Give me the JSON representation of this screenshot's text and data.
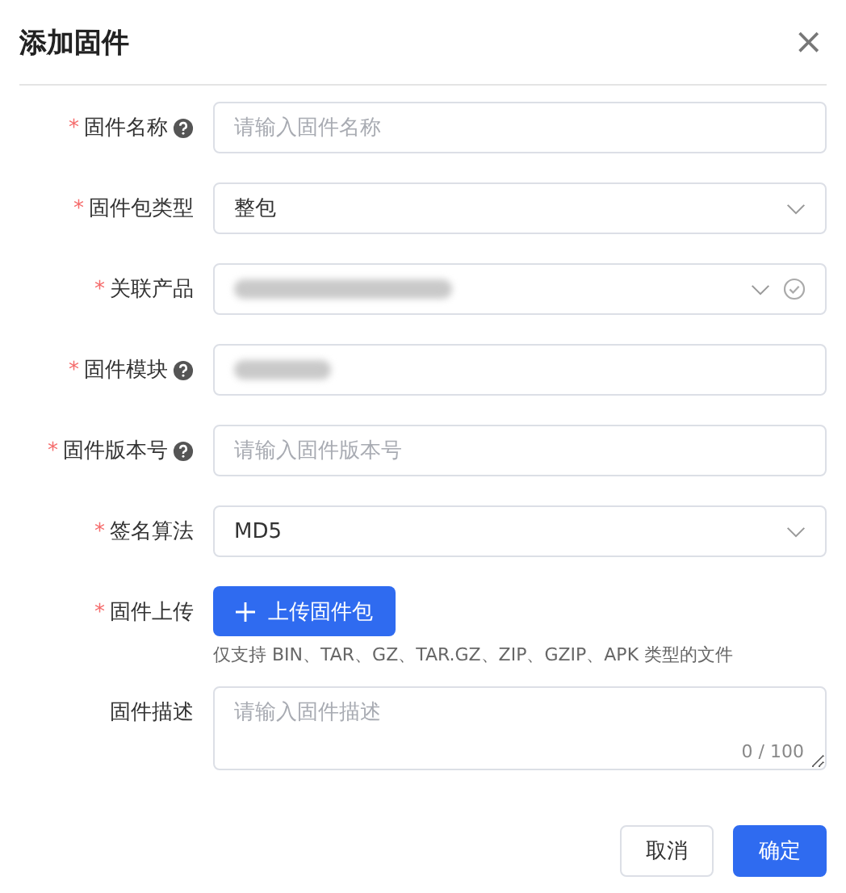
{
  "dialog": {
    "title": "添加固件",
    "close": "×"
  },
  "fields": [
    {
      "kind": "input",
      "required_mark": "*",
      "label": "固件名称",
      "help": true,
      "placeholder": "请输入固件名称"
    },
    {
      "kind": "select",
      "required_mark": "*",
      "label": "固件包类型",
      "value": "整包"
    },
    {
      "kind": "select",
      "required_mark": "*",
      "label": "关联产品",
      "redacted": true,
      "checked": true
    },
    {
      "kind": "input",
      "required_mark": "*",
      "label": "固件模块",
      "help": true,
      "redacted": true
    },
    {
      "kind": "input",
      "required_mark": "*",
      "label": "固件版本号",
      "help": true,
      "placeholder": "请输入固件版本号"
    },
    {
      "kind": "select",
      "required_mark": "*",
      "label": "签名算法",
      "value": "MD5"
    },
    {
      "kind": "upload",
      "required_mark": "*",
      "label": "固件上传",
      "button": "上传固件包",
      "hint": "仅支持 BIN、TAR、GZ、TAR.GZ、ZIP、GZIP、APK 类型的文件"
    },
    {
      "kind": "textarea",
      "label": "固件描述",
      "placeholder": "请输入固件描述",
      "counter": "0 / 100"
    }
  ],
  "buttons": [
    {
      "label": "取消",
      "primary": false
    },
    {
      "label": "确定",
      "primary": true
    }
  ]
}
